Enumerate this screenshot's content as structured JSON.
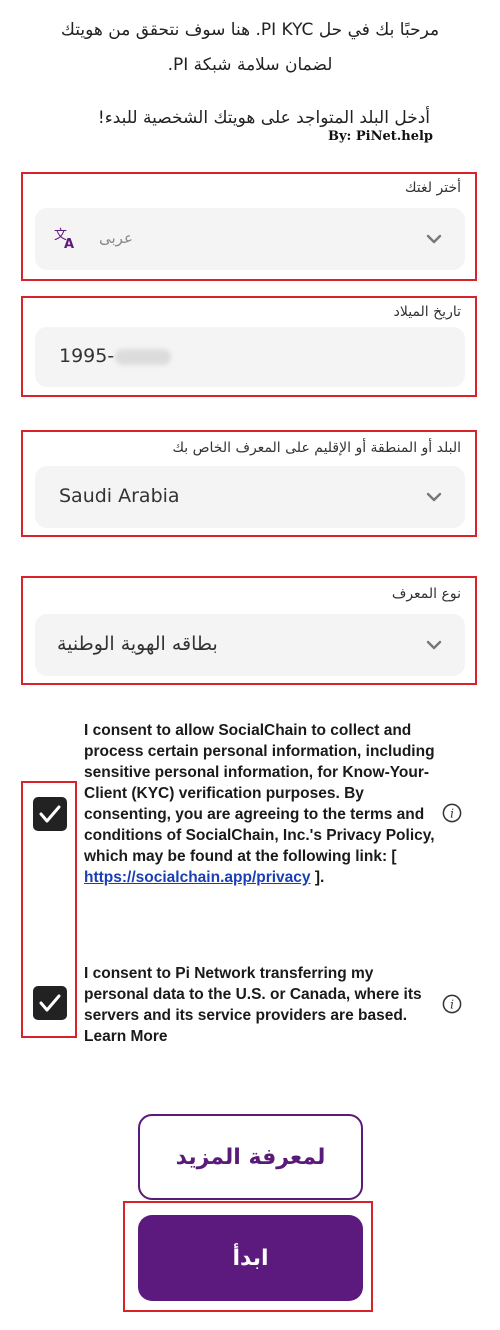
{
  "intro": {
    "line1": "هنا سوف نتحقق من هويتك .PI KYC مرحبًا بك في حل",
    "line2": ".PI لضمان سلامة شبكة",
    "line3": "!أدخل البلد المتواجد على هويتك الشخصية للبدء",
    "credit": "By: PiNet.help"
  },
  "form": {
    "language": {
      "label": "أختر لغتك",
      "value": "عربى"
    },
    "dob": {
      "label": "تاريخ الميلاد",
      "value": "1995-"
    },
    "country": {
      "label": "البلد أو المنطقة أو الإقليم على المعرف الخاص بك",
      "value": "Saudi Arabia"
    },
    "id_type": {
      "label": "نوع المعرف",
      "value": "بطاقه الهوية الوطنية"
    }
  },
  "consents": [
    {
      "text": "I consent to allow SocialChain to collect and process certain personal information, including sensitive personal information, for Know-Your-Client (KYC) verification purposes. By consenting, you are agreeing to the terms and conditions of SocialChain, Inc.'s Privacy Policy, which may be found at the following link: [",
      "link": "https://socialchain.app/privacy",
      "suffix": " ].",
      "checked": true
    },
    {
      "text": "I consent to Pi Network transferring my personal data to the U.S. or Canada, where its servers and its service providers are based. Learn More",
      "checked": true
    }
  ],
  "buttons": {
    "learn_more": "لمعرفة المزيد",
    "start": "ابدأ"
  },
  "colors": {
    "accent": "#5d1a7e",
    "highlight": "#d8232a",
    "link": "#1a3fb5"
  }
}
